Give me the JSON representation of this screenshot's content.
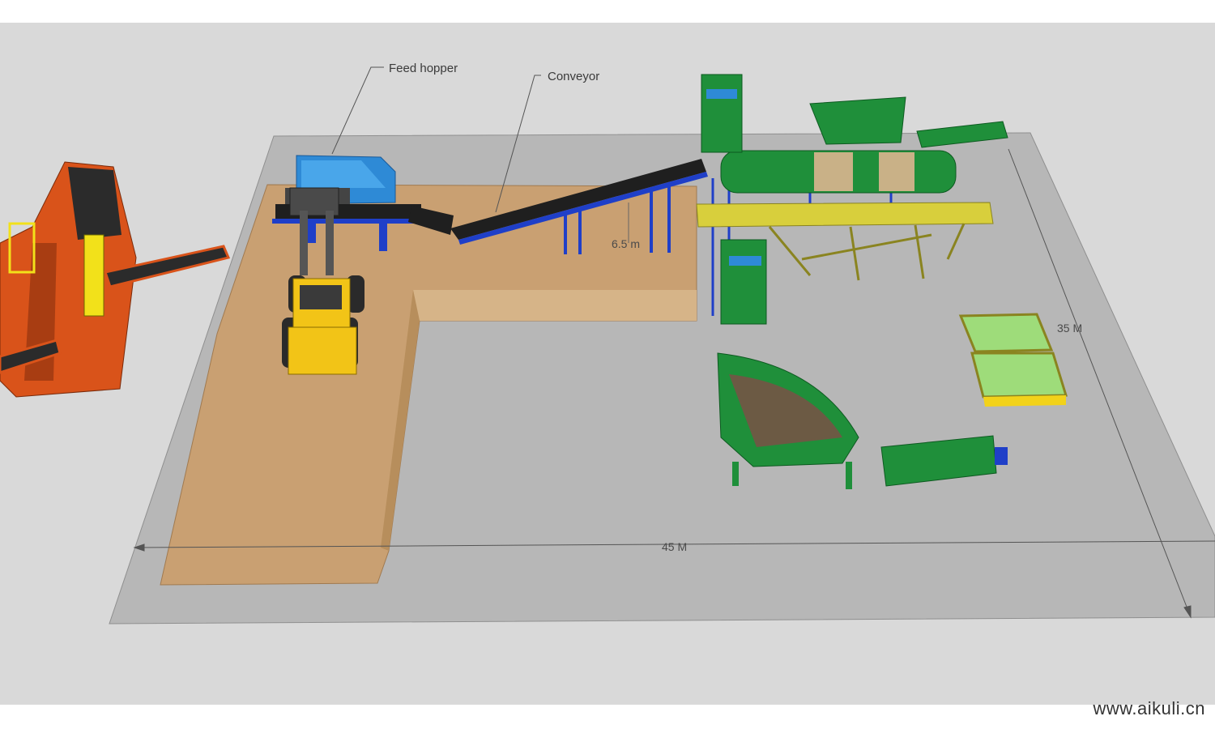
{
  "labels": {
    "feed_hopper": "Feed hopper",
    "conveyor": "Conveyor",
    "height": "6.5 m",
    "length": "45 M",
    "width": "35 M"
  },
  "watermark": "www.aikuli.cn",
  "colors": {
    "ground": "#d9d9d9",
    "pad": "#b4b4b4",
    "sand": "#c9a072",
    "plant_green": "#1f8f3a",
    "frame_yellow": "#d8cf3c",
    "steel_blue": "#1f3fc8",
    "hopper_blue": "#2e8ad6",
    "loader_yellow": "#f2c417",
    "crusher_orange": "#d9531a"
  }
}
